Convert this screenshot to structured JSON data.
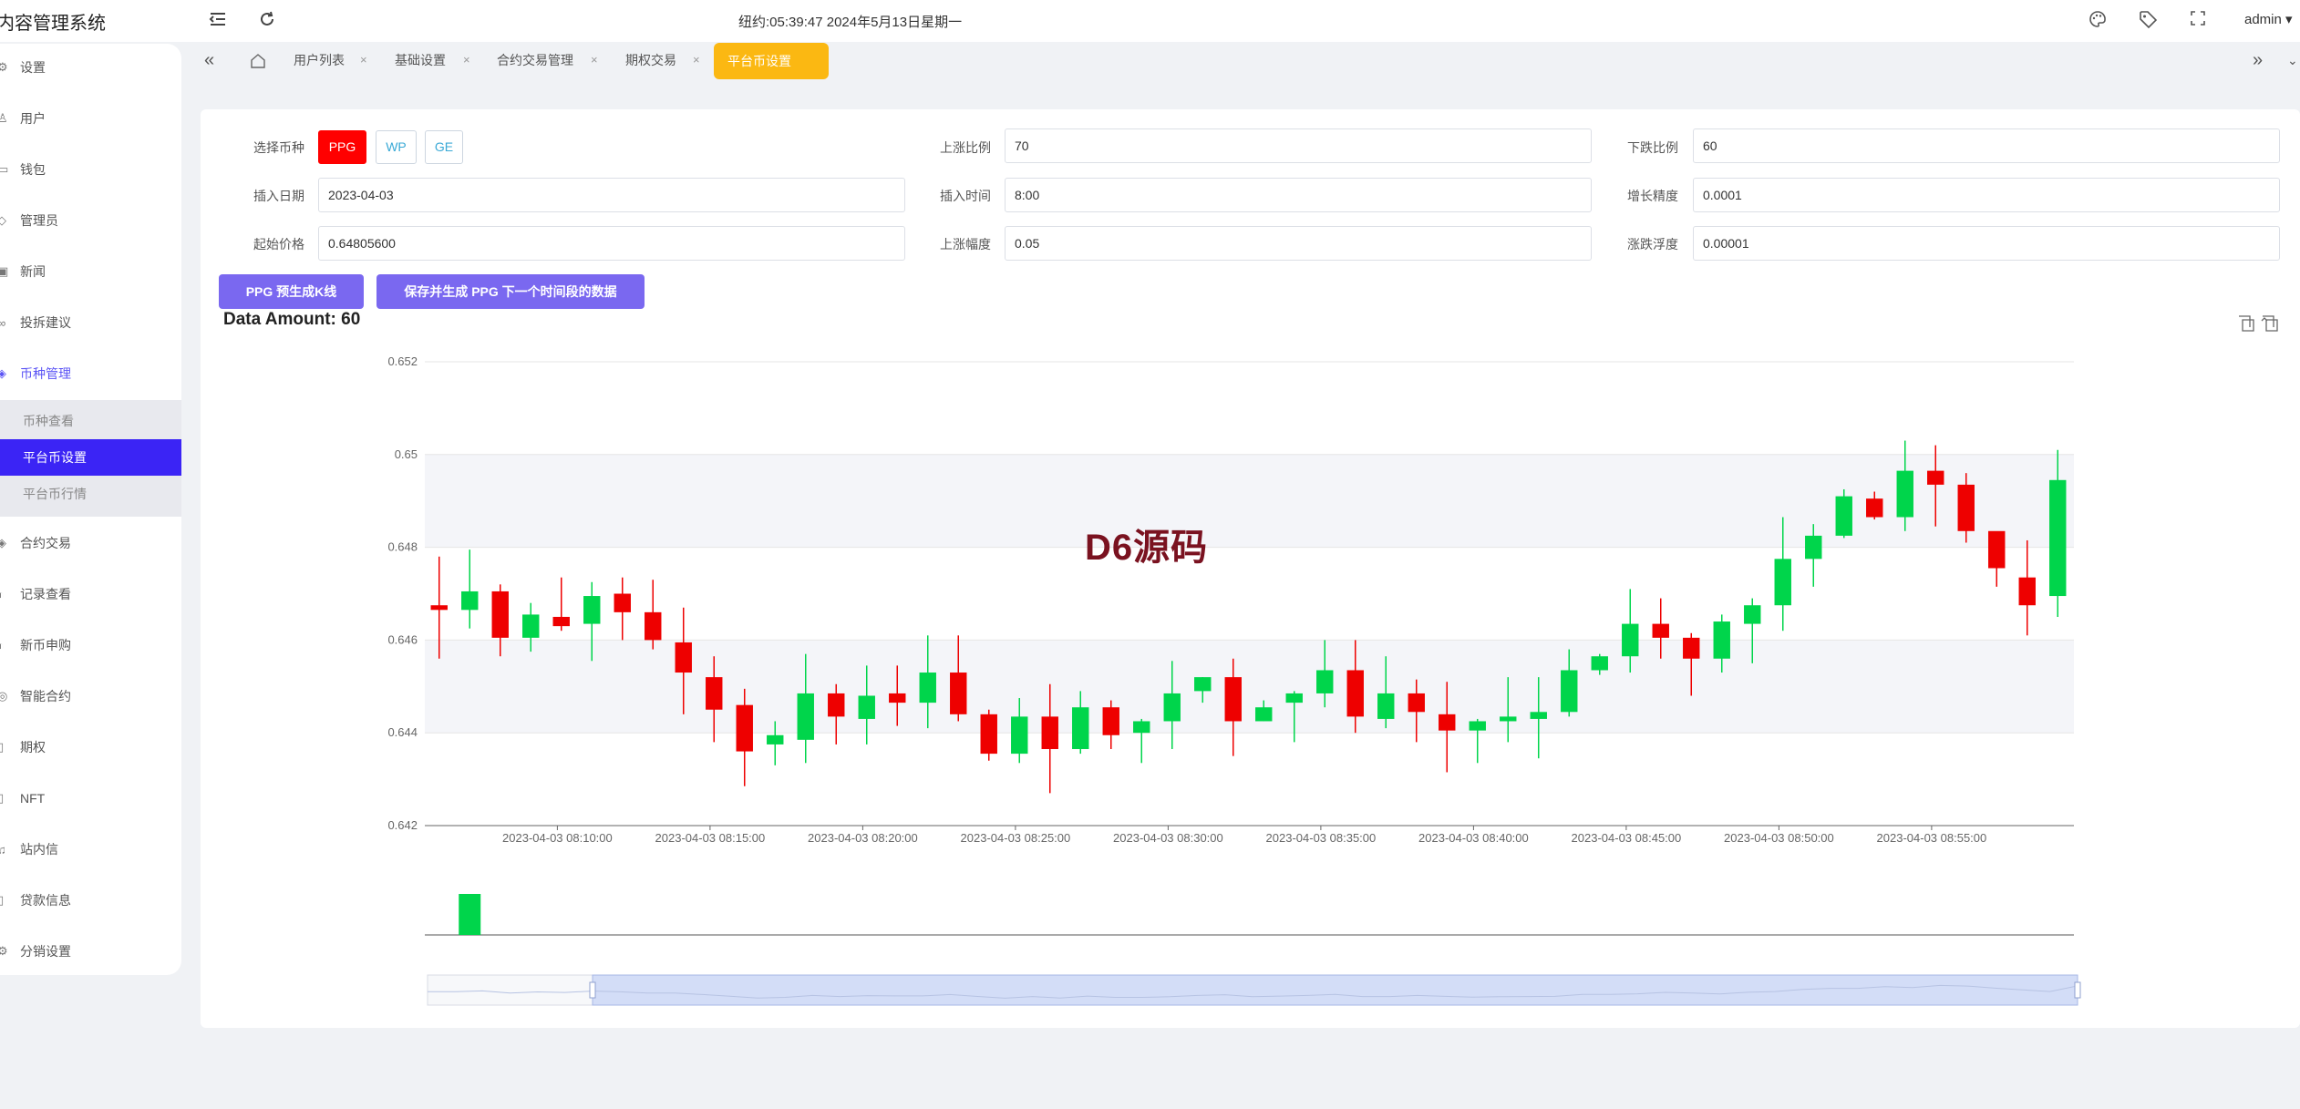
{
  "app": {
    "title": "内容管理系统"
  },
  "header": {
    "clock": "纽约:05:39:47 2024年5月13日星期一",
    "user": "admin ▾"
  },
  "sidebar": {
    "items": [
      {
        "label": "设置",
        "icon": "gear-icon"
      },
      {
        "label": "用户",
        "icon": "user-icon"
      },
      {
        "label": "钱包",
        "icon": "wallet-icon"
      },
      {
        "label": "管理员",
        "icon": "shield-icon"
      },
      {
        "label": "新闻",
        "icon": "news-icon"
      },
      {
        "label": "投拆建议",
        "icon": "link-icon"
      },
      {
        "label": "币种管理",
        "icon": "diamond-icon"
      },
      {
        "label": "合约交易",
        "icon": "diamond-icon"
      },
      {
        "label": "记录查看",
        "icon": "record-icon"
      },
      {
        "label": "新币申购",
        "icon": "record-icon"
      },
      {
        "label": "智能合约",
        "icon": "contract-icon"
      },
      {
        "label": "期权",
        "icon": "document-icon"
      },
      {
        "label": "NFT",
        "icon": "document-icon"
      },
      {
        "label": "站内信",
        "icon": "bell-icon"
      },
      {
        "label": "贷款信息",
        "icon": "document-icon"
      },
      {
        "label": "分销设置",
        "icon": "gear-icon"
      }
    ],
    "submenu": [
      {
        "label": "币种查看"
      },
      {
        "label": "平台币设置"
      },
      {
        "label": "平台币行情"
      }
    ]
  },
  "tabs": [
    {
      "label": "用户列表"
    },
    {
      "label": "基础设置"
    },
    {
      "label": "合约交易管理"
    },
    {
      "label": "期权交易"
    },
    {
      "label": "平台币设置"
    }
  ],
  "tab_close": "×",
  "form": {
    "coin_label": "选择币种",
    "coins": [
      "PPG",
      "WP",
      "GE"
    ],
    "rise_ratio_label": "上涨比例",
    "rise_ratio_value": "70",
    "fall_ratio_label": "下跌比例",
    "fall_ratio_value": "60",
    "insert_date_label": "插入日期",
    "insert_date_value": "2023-04-03",
    "insert_time_label": "插入时间",
    "insert_time_value": "8:00",
    "growth_precision_label": "增长精度",
    "growth_precision_value": "0.0001",
    "start_price_label": "起始价格",
    "start_price_value": "0.64805600",
    "rise_amp_label": "上涨幅度",
    "rise_amp_value": "0.05",
    "float_label": "涨跌浮度",
    "float_value": "0.00001"
  },
  "actions": {
    "generate_label": "PPG 预生成K线",
    "save_label": "保存并生成 PPG 下一个时间段的数据"
  },
  "data_amount": "Data Amount: 60",
  "watermark": "D6源码",
  "colors": {
    "up": "#00d54b",
    "down": "#ee0000",
    "accent": "#fbb812",
    "primary": "#3b24f5",
    "button": "#7a68f0"
  },
  "chart_data": {
    "type": "candlestick",
    "ylim": [
      0.642,
      0.652
    ],
    "yticks": [
      "0.652",
      "0.65",
      "0.648",
      "0.646",
      "0.644",
      "0.642"
    ],
    "xticks": [
      "2023-04-03 08:10:00",
      "2023-04-03 08:15:00",
      "2023-04-03 08:20:00",
      "2023-04-03 08:25:00",
      "2023-04-03 08:30:00",
      "2023-04-03 08:35:00",
      "2023-04-03 08:40:00",
      "2023-04-03 08:45:00",
      "2023-04-03 08:50:00",
      "2023-04-03 08:55:00"
    ],
    "candles": [
      {
        "o": 0.64675,
        "c": 0.64665,
        "h": 0.6478,
        "l": 0.6456
      },
      {
        "o": 0.64665,
        "c": 0.64705,
        "h": 0.64795,
        "l": 0.64625
      },
      {
        "o": 0.64705,
        "c": 0.64605,
        "h": 0.6472,
        "l": 0.64565
      },
      {
        "o": 0.64605,
        "c": 0.64655,
        "h": 0.6468,
        "l": 0.64575
      },
      {
        "o": 0.6465,
        "c": 0.6463,
        "h": 0.64735,
        "l": 0.6462
      },
      {
        "o": 0.64635,
        "c": 0.64695,
        "h": 0.64725,
        "l": 0.64555
      },
      {
        "o": 0.647,
        "c": 0.6466,
        "h": 0.64735,
        "l": 0.646
      },
      {
        "o": 0.6466,
        "c": 0.646,
        "h": 0.6473,
        "l": 0.6458
      },
      {
        "o": 0.64595,
        "c": 0.6453,
        "h": 0.6467,
        "l": 0.6444
      },
      {
        "o": 0.6452,
        "c": 0.6445,
        "h": 0.64565,
        "l": 0.6438
      },
      {
        "o": 0.6446,
        "c": 0.6436,
        "h": 0.64495,
        "l": 0.64285
      },
      {
        "o": 0.64375,
        "c": 0.64395,
        "h": 0.64425,
        "l": 0.6433
      },
      {
        "o": 0.64385,
        "c": 0.64485,
        "h": 0.6457,
        "l": 0.64335
      },
      {
        "o": 0.64485,
        "c": 0.64435,
        "h": 0.64505,
        "l": 0.64375
      },
      {
        "o": 0.6443,
        "c": 0.6448,
        "h": 0.64545,
        "l": 0.64375
      },
      {
        "o": 0.64485,
        "c": 0.64465,
        "h": 0.64545,
        "l": 0.64415
      },
      {
        "o": 0.64465,
        "c": 0.6453,
        "h": 0.6461,
        "l": 0.6441
      },
      {
        "o": 0.6453,
        "c": 0.6444,
        "h": 0.6461,
        "l": 0.64425
      },
      {
        "o": 0.6444,
        "c": 0.64355,
        "h": 0.6445,
        "l": 0.6434
      },
      {
        "o": 0.64355,
        "c": 0.64435,
        "h": 0.64475,
        "l": 0.64335
      },
      {
        "o": 0.64435,
        "c": 0.64365,
        "h": 0.64505,
        "l": 0.6427
      },
      {
        "o": 0.64365,
        "c": 0.64455,
        "h": 0.6449,
        "l": 0.64355
      },
      {
        "o": 0.64455,
        "c": 0.64395,
        "h": 0.6447,
        "l": 0.64365
      },
      {
        "o": 0.644,
        "c": 0.64425,
        "h": 0.6443,
        "l": 0.64335
      },
      {
        "o": 0.64425,
        "c": 0.64485,
        "h": 0.64555,
        "l": 0.64365
      },
      {
        "o": 0.6449,
        "c": 0.6452,
        "h": 0.6452,
        "l": 0.64465
      },
      {
        "o": 0.6452,
        "c": 0.64425,
        "h": 0.6456,
        "l": 0.6435
      },
      {
        "o": 0.64425,
        "c": 0.64455,
        "h": 0.6447,
        "l": 0.64425
      },
      {
        "o": 0.64465,
        "c": 0.64485,
        "h": 0.6449,
        "l": 0.6438
      },
      {
        "o": 0.64485,
        "c": 0.64535,
        "h": 0.646,
        "l": 0.64455
      },
      {
        "o": 0.64535,
        "c": 0.64435,
        "h": 0.646,
        "l": 0.644
      },
      {
        "o": 0.6443,
        "c": 0.64485,
        "h": 0.64565,
        "l": 0.6441
      },
      {
        "o": 0.64485,
        "c": 0.64445,
        "h": 0.64515,
        "l": 0.6438
      },
      {
        "o": 0.6444,
        "c": 0.64405,
        "h": 0.6451,
        "l": 0.64315
      },
      {
        "o": 0.64405,
        "c": 0.64425,
        "h": 0.6443,
        "l": 0.64335
      },
      {
        "o": 0.64425,
        "c": 0.64435,
        "h": 0.6452,
        "l": 0.6438
      },
      {
        "o": 0.6443,
        "c": 0.64445,
        "h": 0.6452,
        "l": 0.64345
      },
      {
        "o": 0.64445,
        "c": 0.64535,
        "h": 0.6458,
        "l": 0.64435
      },
      {
        "o": 0.64535,
        "c": 0.64565,
        "h": 0.6457,
        "l": 0.64525
      },
      {
        "o": 0.64565,
        "c": 0.64635,
        "h": 0.6471,
        "l": 0.6453
      },
      {
        "o": 0.64635,
        "c": 0.64605,
        "h": 0.6469,
        "l": 0.6456
      },
      {
        "o": 0.64605,
        "c": 0.6456,
        "h": 0.64615,
        "l": 0.6448
      },
      {
        "o": 0.6456,
        "c": 0.6464,
        "h": 0.64655,
        "l": 0.6453
      },
      {
        "o": 0.64635,
        "c": 0.64675,
        "h": 0.6469,
        "l": 0.6455
      },
      {
        "o": 0.64675,
        "c": 0.64775,
        "h": 0.64865,
        "l": 0.6462
      },
      {
        "o": 0.64775,
        "c": 0.64825,
        "h": 0.6485,
        "l": 0.64715
      },
      {
        "o": 0.64825,
        "c": 0.6491,
        "h": 0.64925,
        "l": 0.6482
      },
      {
        "o": 0.64905,
        "c": 0.64865,
        "h": 0.6492,
        "l": 0.6486
      },
      {
        "o": 0.64865,
        "c": 0.64965,
        "h": 0.6503,
        "l": 0.64835
      },
      {
        "o": 0.64965,
        "c": 0.64935,
        "h": 0.6502,
        "l": 0.64845
      },
      {
        "o": 0.64935,
        "c": 0.64835,
        "h": 0.6496,
        "l": 0.6481
      },
      {
        "o": 0.64835,
        "c": 0.64755,
        "h": 0.6481,
        "l": 0.64715
      },
      {
        "o": 0.64735,
        "c": 0.64675,
        "h": 0.64815,
        "l": 0.6461
      },
      {
        "o": 0.64695,
        "c": 0.64945,
        "h": 0.6501,
        "l": 0.6465
      }
    ],
    "volume_bar": {
      "index": 1,
      "color": "#00d54b"
    },
    "datazoom_range_pct": [
      10,
      100
    ]
  }
}
